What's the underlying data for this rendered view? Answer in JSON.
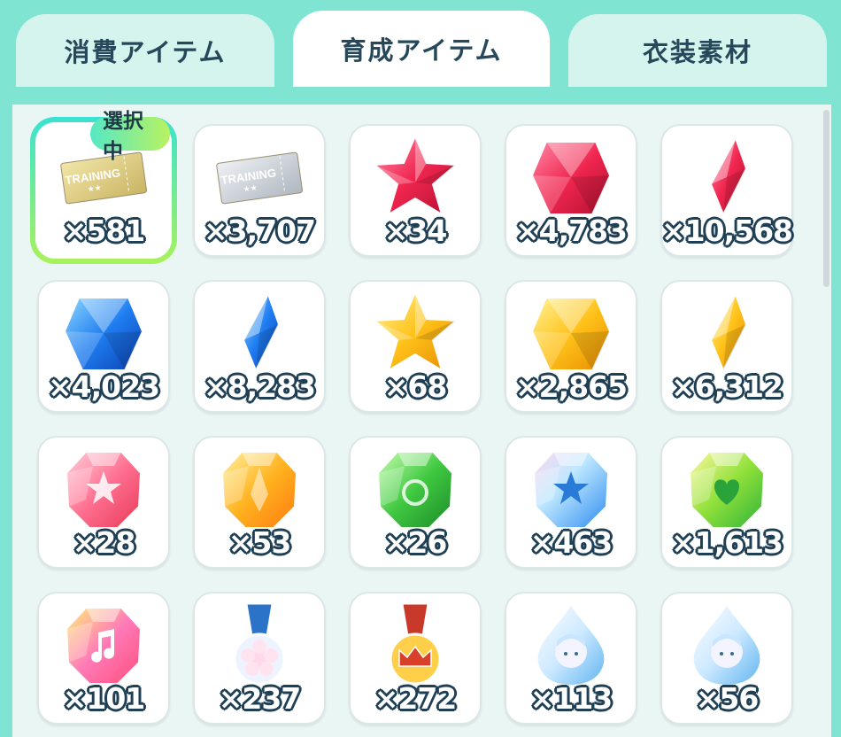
{
  "tabs": [
    {
      "label": "消費アイテム",
      "active": false
    },
    {
      "label": "育成アイテム",
      "active": true
    },
    {
      "label": "衣装素材",
      "active": false
    }
  ],
  "selected_badge": "選択中",
  "items": [
    {
      "icon": "gold-training-ticket-icon",
      "count": "×581",
      "selected": true,
      "ticket_text": "TRAINING",
      "ticket_grade": "GOLD"
    },
    {
      "icon": "silver-training-ticket-icon",
      "count": "×3,707",
      "ticket_text": "TRAINING",
      "ticket_grade": "SILVER"
    },
    {
      "icon": "red-star-gem-icon",
      "count": "×34"
    },
    {
      "icon": "red-square-gem-icon",
      "count": "×4,783"
    },
    {
      "icon": "red-shard-gem-icon",
      "count": "×10,568"
    },
    {
      "icon": "blue-square-gem-icon",
      "count": "×4,023"
    },
    {
      "icon": "blue-shard-gem-icon",
      "count": "×8,283"
    },
    {
      "icon": "yellow-star-gem-icon",
      "count": "×68"
    },
    {
      "icon": "yellow-square-gem-icon",
      "count": "×2,865"
    },
    {
      "icon": "yellow-shard-gem-icon",
      "count": "×6,312"
    },
    {
      "icon": "pink-star-crystal-icon",
      "count": "×28"
    },
    {
      "icon": "orange-crystal-icon",
      "count": "×53"
    },
    {
      "icon": "green-crystal-icon",
      "count": "×26"
    },
    {
      "icon": "blue-star-crystal-icon",
      "count": "×463"
    },
    {
      "icon": "green-heart-crystal-icon",
      "count": "×1,613"
    },
    {
      "icon": "music-note-crystal-icon",
      "count": "×101"
    },
    {
      "icon": "blue-flower-medal-icon",
      "count": "×237"
    },
    {
      "icon": "red-crown-medal-icon",
      "count": "×272"
    },
    {
      "icon": "blue-character-drop-icon",
      "count": "×113"
    },
    {
      "icon": "blue-character-drop-icon",
      "count": "×56"
    }
  ],
  "colors": {
    "background": "#7fe4d2",
    "panel": "#e9f6f3",
    "count_outline": "#1f3f55",
    "tab_text": "#27485a"
  }
}
